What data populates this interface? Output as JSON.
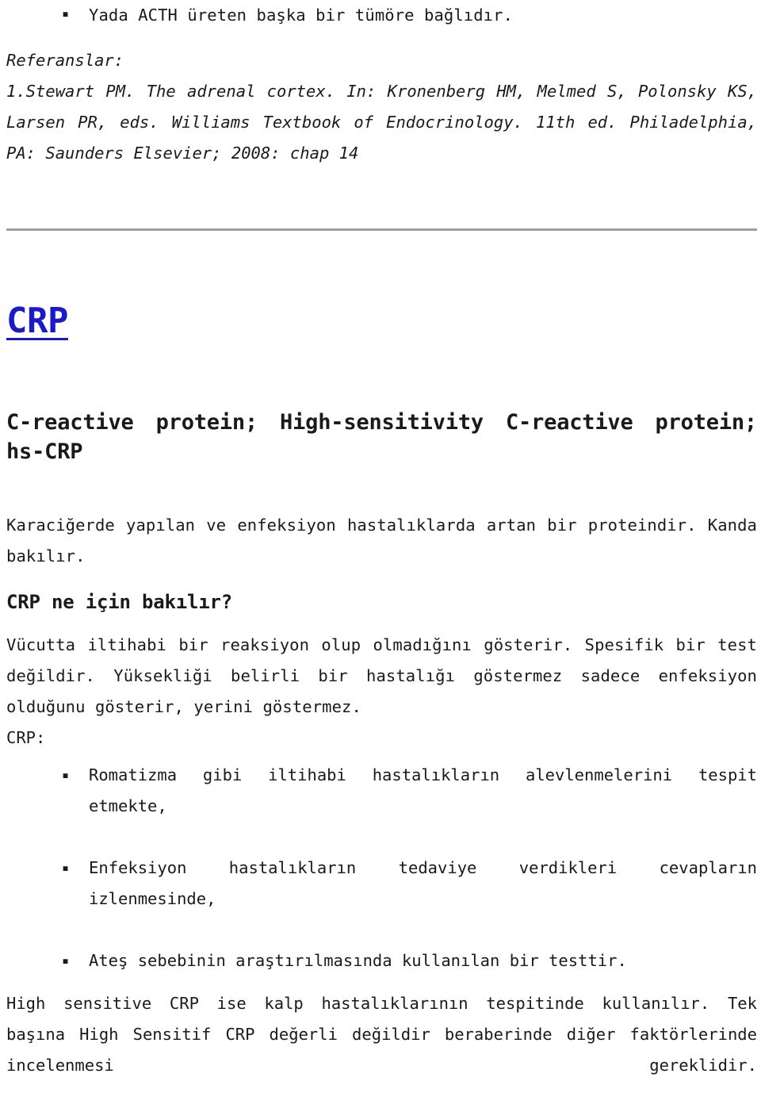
{
  "page": {
    "language": "tr",
    "background_color": "#ffffff",
    "text_color": "#1a1a1a",
    "divider_color": "#9e9e9e",
    "link_color": "#1a1aca"
  },
  "top_section": {
    "bullets": [
      "Yada ACTH üreten başka bir tümöre bağlıdır."
    ]
  },
  "references": {
    "label": "Referanslar:",
    "entries": [
      "1.Stewart PM. The adrenal cortex. In: Kronenberg HM, Melmed S, Polonsky KS, Larsen PR, eds. Williams Textbook of Endocrinology. 11th ed. Philadelphia, PA: Saunders Elsevier; 2008: chap 14"
    ]
  },
  "article": {
    "anchor_link": "CRP",
    "title": "C-reactive protein; High-sensitivity C-reactive protein; hs-CRP",
    "intro": "Karaciğerde yapılan ve enfeksiyon hastalıklarda artan bir proteindir. Kanda bakılır.",
    "sub_heading": "CRP ne için bakılır?",
    "description": "Vücutta iltihabi bir reaksiyon olup olmadığını gösterir. Spesifik bir test değildir. Yüksekliği belirli bir hastalığı göstermez sadece enfeksiyon olduğunu gösterir, yerini göstermez.",
    "list_label": "CRP:",
    "uses": [
      "Romatizma gibi iltihabi hastalıkların alevlenmelerini tespit etmekte,",
      "Enfeksiyon hastalıkların tedaviye verdikleri cevapların izlenmesinde,",
      "Ateş sebebinin araştırılmasında kullanılan bir testtir."
    ],
    "closing": "High sensitive CRP ise kalp hastalıklarının tespitinde kullanılır. Tek başına High Sensitif CRP değerli değildir beraberinde diğer faktörlerinde incelenmesi gereklidir."
  }
}
